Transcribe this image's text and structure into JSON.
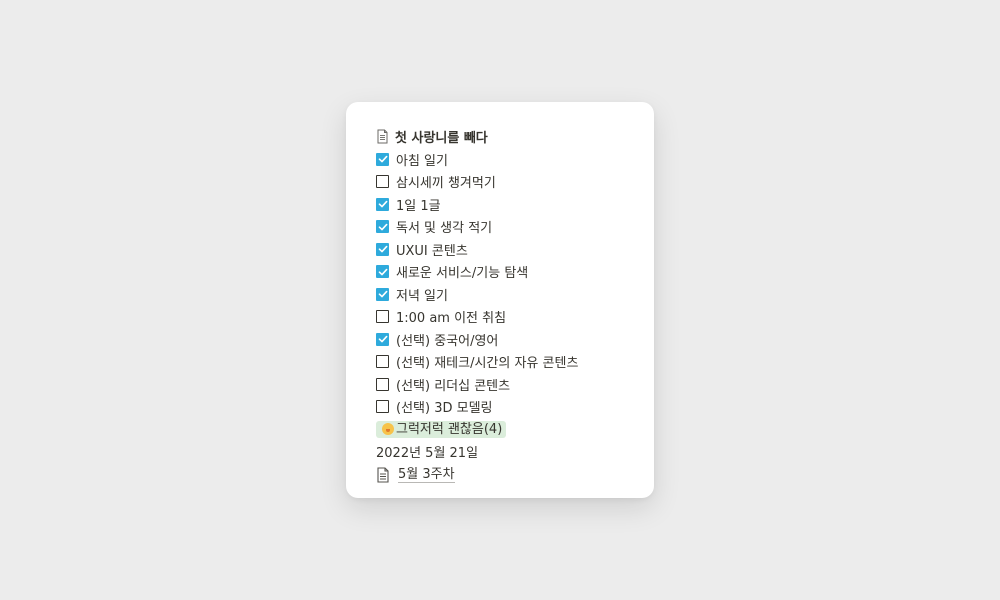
{
  "page": {
    "title": "첫 사랑니를 빼다"
  },
  "todos": [
    {
      "label": "아침 일기",
      "checked": true
    },
    {
      "label": "삼시세끼 챙겨먹기",
      "checked": false
    },
    {
      "label": "1일 1글",
      "checked": true
    },
    {
      "label": "독서 및 생각 적기",
      "checked": true
    },
    {
      "label": "UXUI 콘텐츠",
      "checked": true
    },
    {
      "label": "새로운 서비스/기능 탐색",
      "checked": true
    },
    {
      "label": "저녁 일기",
      "checked": true
    },
    {
      "label": "1:00 am 이전 취침",
      "checked": false
    },
    {
      "label": "(선택) 중국어/영어",
      "checked": true
    },
    {
      "label": "(선택) 재테크/시간의 자유 콘텐츠",
      "checked": false
    },
    {
      "label": "(선택) 리더십 콘텐츠",
      "checked": false
    },
    {
      "label": "(선택) 3D 모델링",
      "checked": false
    }
  ],
  "mood_tag": {
    "emoji": "hushed-face-emoji",
    "label": "그럭저럭 괜찮음(4)",
    "color": "#dbeddb"
  },
  "date": "2022년 5월 21일",
  "linked_page": {
    "label": "5월 3주차",
    "icon": "page-icon"
  },
  "colors": {
    "checkbox_checked": "#2eaadc",
    "text": "#37352f",
    "background": "#ececec",
    "card": "#ffffff"
  }
}
